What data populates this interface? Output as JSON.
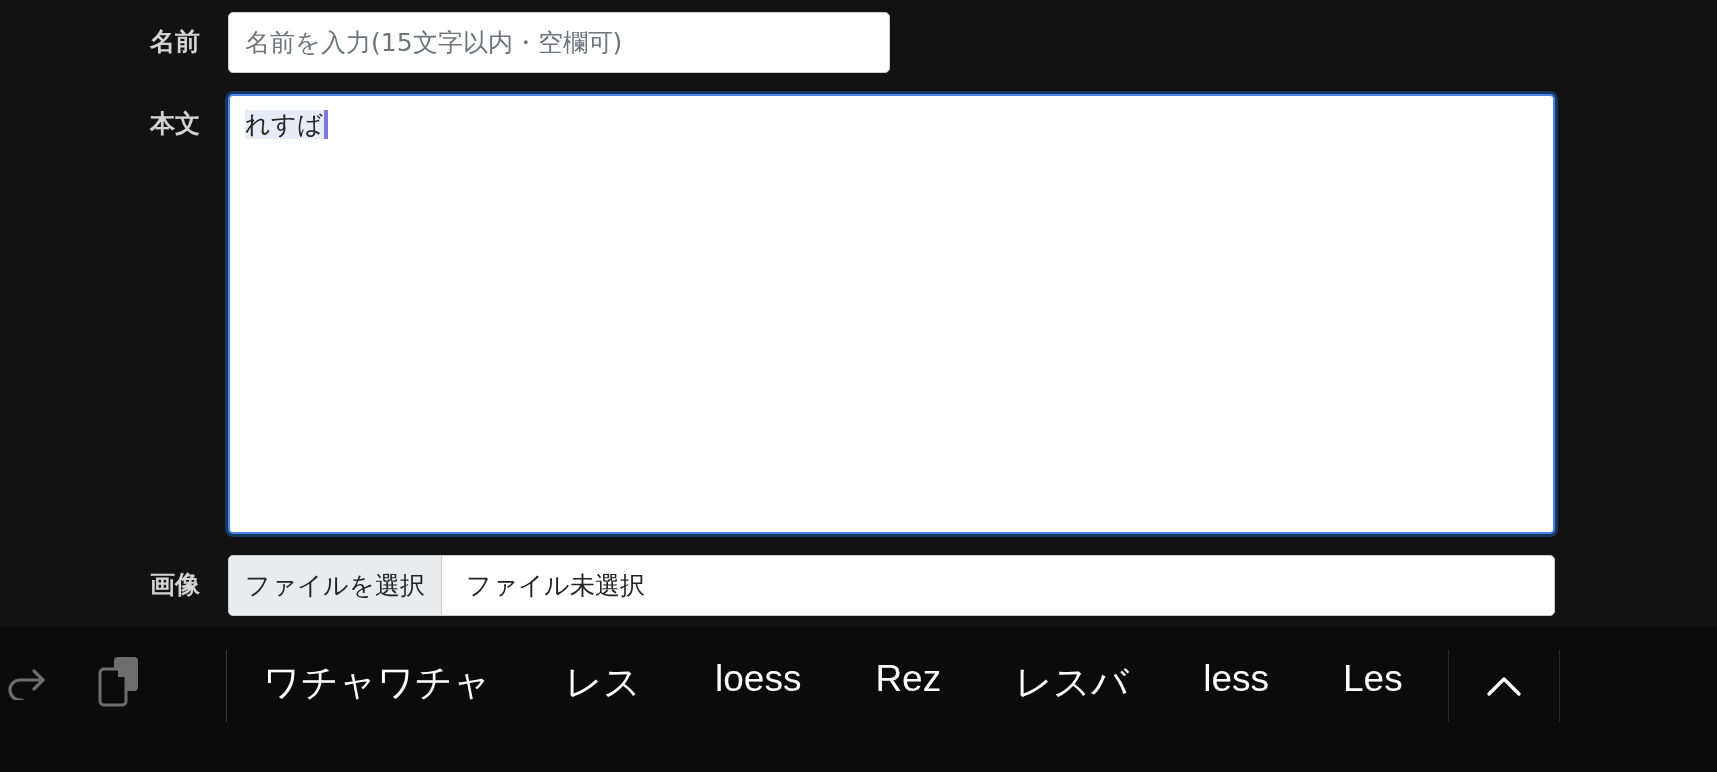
{
  "form": {
    "name": {
      "label": "名前",
      "placeholder": "名前を入力(15文字以内・空欄可)"
    },
    "body": {
      "label": "本文",
      "value": "れすば",
      "composing": true,
      "focused": true
    },
    "image": {
      "label": "画像",
      "button": "ファイルを選択",
      "status": "ファイル未選択"
    }
  },
  "keyboard_bar": {
    "suggestions": [
      "ワチャワチャ",
      "レス",
      "loess",
      "Rez",
      "レスバ",
      "less",
      "Les"
    ]
  }
}
